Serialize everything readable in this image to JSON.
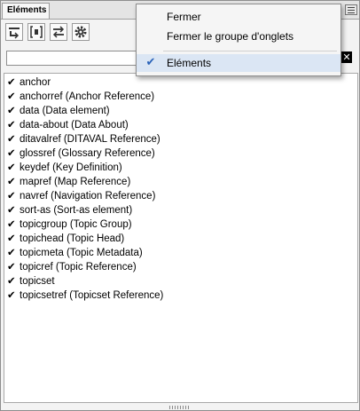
{
  "panel": {
    "tab_label": "Eléments",
    "toolbar": [
      {
        "icon": "insert-before-icon"
      },
      {
        "icon": "wrap-element-icon"
      },
      {
        "icon": "swap-icon"
      },
      {
        "icon": "gear-icon"
      }
    ],
    "search": {
      "value": "",
      "placeholder": ""
    },
    "clear_label": "✕",
    "items": [
      {
        "label": "anchor"
      },
      {
        "label": "anchorref  (Anchor Reference)"
      },
      {
        "label": "data  (Data element)"
      },
      {
        "label": "data-about  (Data About)"
      },
      {
        "label": "ditavalref  (DITAVAL Reference)"
      },
      {
        "label": "glossref  (Glossary Reference)"
      },
      {
        "label": "keydef  (Key Definition)"
      },
      {
        "label": "mapref  (Map Reference)"
      },
      {
        "label": "navref  (Navigation Reference)"
      },
      {
        "label": "sort-as  (Sort-as element)"
      },
      {
        "label": "topicgroup  (Topic Group)"
      },
      {
        "label": "topichead  (Topic Head)"
      },
      {
        "label": "topicmeta  (Topic Metadata)"
      },
      {
        "label": "topicref  (Topic Reference)"
      },
      {
        "label": "topicset"
      },
      {
        "label": "topicsetref  (Topicset Reference)"
      }
    ],
    "check_glyph": "✔"
  },
  "menu": {
    "items": [
      {
        "label": "Fermer",
        "checked": false
      },
      {
        "label": "Fermer le groupe d'onglets",
        "checked": false
      },
      {
        "label": "Eléments",
        "checked": true
      }
    ],
    "check_glyph": "✔"
  },
  "colors": {
    "accent": "#2a63b9",
    "menu_highlight": "#dbe6f4"
  }
}
